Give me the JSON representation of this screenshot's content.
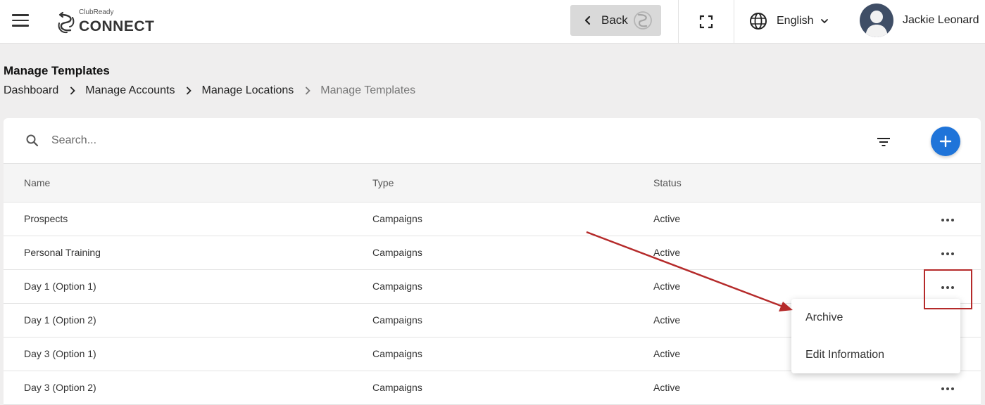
{
  "header": {
    "logo_small": "ClubReady",
    "logo_big": "CONNECT",
    "back_label": "Back",
    "language": "English",
    "user_name": "Jackie Leonard"
  },
  "page": {
    "title": "Manage Templates",
    "breadcrumb": [
      "Dashboard",
      "Manage Accounts",
      "Manage Locations",
      "Manage Templates"
    ]
  },
  "search": {
    "placeholder": "Search..."
  },
  "table": {
    "columns": [
      "Name",
      "Type",
      "Status"
    ],
    "rows": [
      {
        "name": "Prospects",
        "type": "Campaigns",
        "status": "Active"
      },
      {
        "name": "Personal Training",
        "type": "Campaigns",
        "status": "Active"
      },
      {
        "name": "Day 1 (Option 1)",
        "type": "Campaigns",
        "status": "Active"
      },
      {
        "name": "Day 1 (Option 2)",
        "type": "Campaigns",
        "status": "Active"
      },
      {
        "name": "Day 3 (Option 1)",
        "type": "Campaigns",
        "status": "Active"
      },
      {
        "name": "Day 3 (Option 2)",
        "type": "Campaigns",
        "status": "Active"
      }
    ]
  },
  "row_menu": {
    "items": [
      "Archive",
      "Edit Information"
    ]
  },
  "colors": {
    "accent": "#1f74d9",
    "annotation": "#b52a2a",
    "background": "#efeeee"
  },
  "icons": [
    "hamburger-menu-icon",
    "chevron-left-icon",
    "fullscreen-icon",
    "globe-icon",
    "chevron-down-icon",
    "chevron-right-icon",
    "search-icon",
    "filter-icon",
    "plus-icon",
    "more-horizontal-icon"
  ]
}
